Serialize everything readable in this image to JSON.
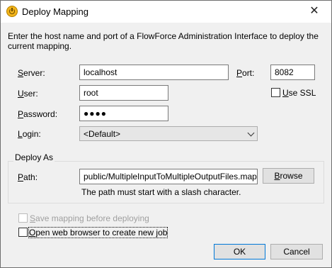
{
  "window": {
    "title": "Deploy Mapping",
    "close_glyph": "✕",
    "app_icon": "altova-mapforce-icon"
  },
  "intro_text": "Enter the host name and port of a FlowForce Administration Interface to deploy the current mapping.",
  "server": {
    "label_accel": "S",
    "label_rest": "erver:",
    "value": "localhost"
  },
  "port": {
    "label_accel": "P",
    "label_rest": "ort:",
    "value": "8082"
  },
  "use_ssl": {
    "label_accel": "U",
    "label_rest": "se SSL",
    "checked": false
  },
  "user": {
    "label_accel": "U",
    "label_rest": "ser:",
    "value": "root"
  },
  "password": {
    "label_accel": "P",
    "label_rest": "assword:",
    "value": "●●●●"
  },
  "login": {
    "label_accel": "L",
    "label_rest": "ogin:",
    "selected": "<Default>"
  },
  "deploy_as": {
    "title": "Deploy As",
    "path_label_accel": "P",
    "path_label_rest": "ath:",
    "path_value": "public/MultipleInputToMultipleOutputFiles.mapping",
    "browse_accel": "B",
    "browse_rest": "rowse",
    "hint": "The path must start with a slash character."
  },
  "save_mapping": {
    "label_accel": "S",
    "label_rest": "ave mapping before deploying",
    "checked": false,
    "enabled": false
  },
  "open_browser": {
    "label_accel": "O",
    "label_rest": "pen web browser to create new job",
    "checked": false
  },
  "buttons": {
    "ok": "OK",
    "cancel": "Cancel"
  }
}
